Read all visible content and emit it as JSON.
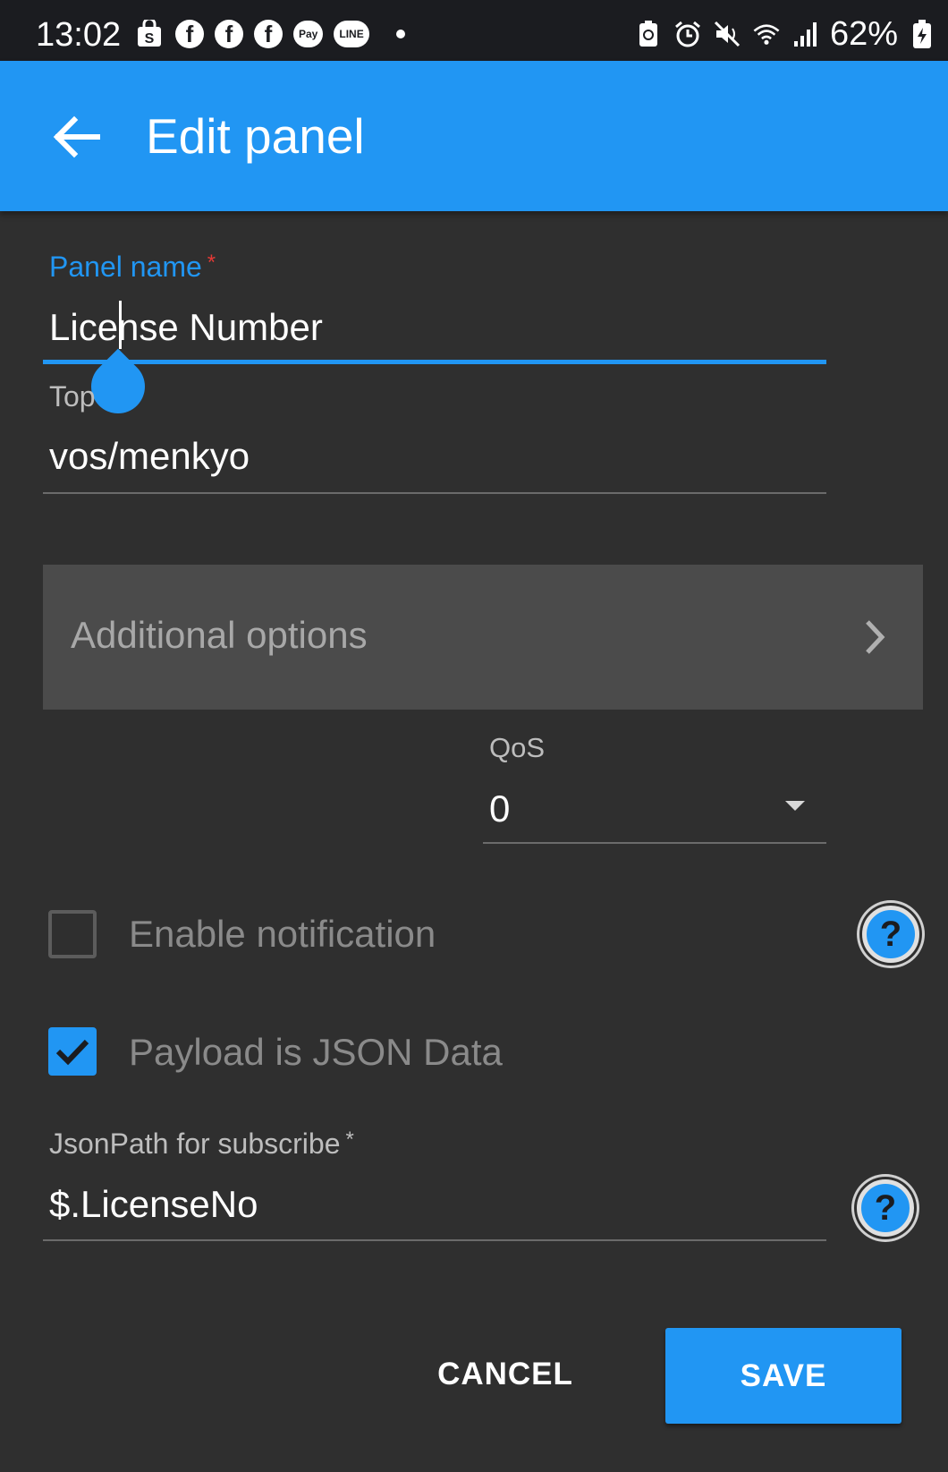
{
  "status_bar": {
    "time": "13:02",
    "pay_label": "Pay",
    "line_label": "LINE",
    "battery_percent": "62%",
    "left_icons": [
      "shopping-bag-icon",
      "facebook-icon",
      "facebook-icon",
      "facebook-icon",
      "pay-icon",
      "line-icon",
      "notification-dot-icon"
    ],
    "right_icons": [
      "battery-saver-icon",
      "alarm-icon",
      "mute-icon",
      "wifi-icon",
      "signal-icon",
      "battery-charging-icon"
    ]
  },
  "app_bar": {
    "title": "Edit panel",
    "back_icon": "arrow-left-icon",
    "color": "#2196f3"
  },
  "form": {
    "panel_name": {
      "label": "Panel name",
      "required_mark": "*",
      "value": "License Number"
    },
    "topic": {
      "label": "Top",
      "value": "vos/menkyo"
    },
    "additional_options": {
      "label": "Additional options",
      "icon": "chevron-right-icon"
    },
    "qos": {
      "label": "QoS",
      "value": "0"
    },
    "enable_notification": {
      "label": "Enable notification",
      "checked": false
    },
    "payload_json": {
      "label": "Payload is JSON Data",
      "checked": true
    },
    "jsonpath": {
      "label": "JsonPath for subscribe",
      "required_mark": "*",
      "value": "$.LicenseNo"
    },
    "help_glyph": "?"
  },
  "actions": {
    "cancel_label": "CANCEL",
    "save_label": "SAVE"
  },
  "colors": {
    "accent": "#2196f3",
    "background": "#2f2f2f",
    "required": "#e53935"
  }
}
